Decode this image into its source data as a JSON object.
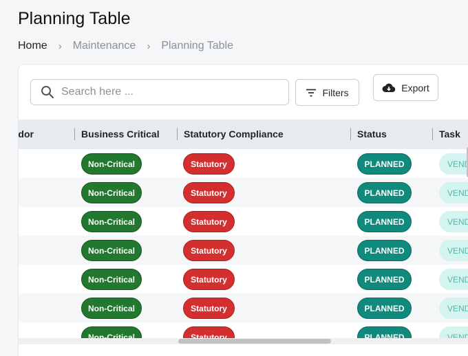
{
  "page": {
    "title": "Planning Table"
  },
  "breadcrumb": {
    "items": [
      "Home",
      "Maintenance",
      "Planning Table"
    ]
  },
  "toolbar": {
    "search_placeholder": "Search here ...",
    "filters_label": "Filters",
    "export_label": "Export"
  },
  "table": {
    "columns": [
      "Vendor",
      "Business Critical",
      "Statutory Compliance",
      "Status",
      "Task"
    ],
    "rows": [
      {
        "business_critical": "Non-Critical",
        "statutory": "Statutory",
        "status": "PLANNED",
        "task": "VENDOR"
      },
      {
        "business_critical": "Non-Critical",
        "statutory": "Statutory",
        "status": "PLANNED",
        "task": "VENDOR"
      },
      {
        "business_critical": "Non-Critical",
        "statutory": "Statutory",
        "status": "PLANNED",
        "task": "VENDOR"
      },
      {
        "business_critical": "Non-Critical",
        "statutory": "Statutory",
        "status": "PLANNED",
        "task": "VENDOR"
      },
      {
        "business_critical": "Non-Critical",
        "statutory": "Statutory",
        "status": "PLANNED",
        "task": "VENDOR"
      },
      {
        "business_critical": "Non-Critical",
        "statutory": "Statutory",
        "status": "PLANNED",
        "task": "VENDOR"
      },
      {
        "business_critical": "Non-Critical",
        "statutory": "Statutory",
        "status": "PLANNED",
        "task": "VENDOR"
      }
    ]
  },
  "colors": {
    "green": "#22782e",
    "red": "#d32f2f",
    "teal": "#0f8a7c",
    "task_bg": "#d4f4f0",
    "header_bg": "#e7ebf0"
  },
  "icons": {
    "search": "search-icon",
    "filters": "filter-lines-icon",
    "export": "cloud-download-icon",
    "column_grip": "drag-grip-icon",
    "breadcrumb_sep": "chevron-right-icon"
  }
}
